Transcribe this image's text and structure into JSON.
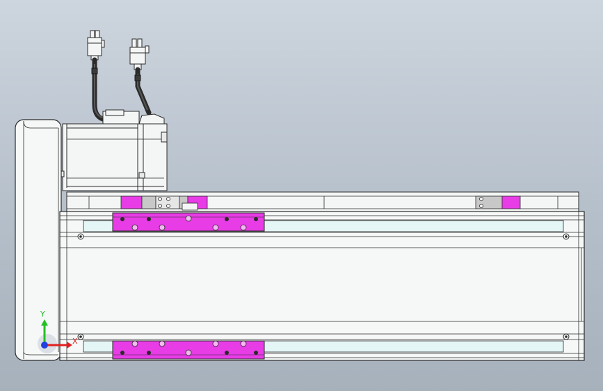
{
  "viewport": {
    "background_top": "#cdd5de",
    "background_bottom": "#a7b1bc"
  },
  "model": {
    "colors": {
      "body": "#f4f6f6",
      "outline": "#2a2a2a",
      "carriage": "#e83ce6",
      "cable": "#2b2b2b",
      "cover_strip": "#e4f6f6",
      "bracket": "#c8c8c8"
    },
    "parts": {
      "end_cap": "end-cap",
      "motor": "servo-motor",
      "carriage_top": "carriage-top",
      "carriage_bottom": "carriage-bottom",
      "connector_left": "cable-connector-left",
      "connector_right": "cable-connector-right"
    }
  },
  "triad": {
    "x_label": "X",
    "y_label": "Y",
    "x_color": "#e02020",
    "y_color": "#22c022",
    "z_color": "#2040e0"
  }
}
